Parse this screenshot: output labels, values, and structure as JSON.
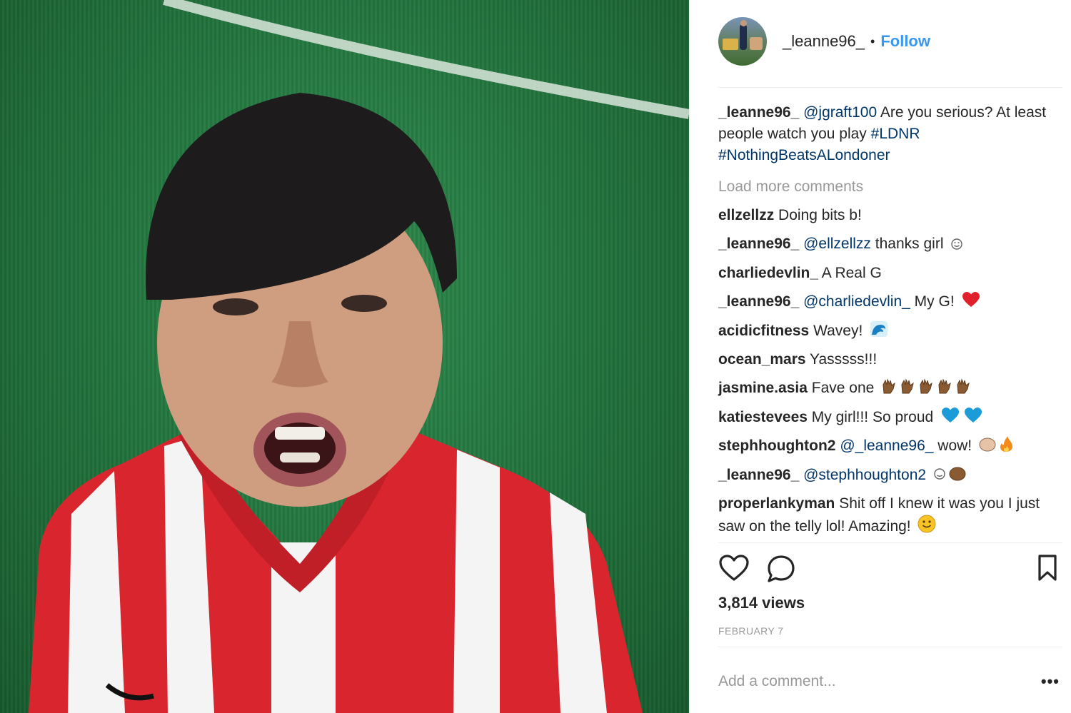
{
  "post": {
    "header": {
      "username": "_leanne96_",
      "separator": "•",
      "follow_label": "Follow"
    },
    "caption": {
      "username": "_leanne96_",
      "mention": "@jgraft100",
      "text": " Are you serious? At least people watch you play ",
      "hashtag1": "#LDNR",
      "hashtag2": "#NothingBeatsALondoner"
    },
    "load_more_label": "Load more comments",
    "comments": [
      {
        "user": "ellzellzz",
        "mention": "",
        "text": "Doing bits b!"
      },
      {
        "user": "_leanne96_",
        "mention": "@ellzellzz",
        "text": "thanks girl"
      },
      {
        "user": "charliedevlin_",
        "mention": "",
        "text": "A Real G"
      },
      {
        "user": "_leanne96_",
        "mention": "@charliedevlin_",
        "text": "My G!"
      },
      {
        "user": "acidicfitness",
        "mention": "",
        "text": "Wavey!"
      },
      {
        "user": "ocean_mars",
        "mention": "",
        "text": "Yasssss!!!"
      },
      {
        "user": "jasmine.asia",
        "mention": "",
        "text": "Fave one"
      },
      {
        "user": "katiestevees",
        "mention": "",
        "text": "My girl!!! So proud"
      },
      {
        "user": "stephhoughton2",
        "mention": "@_leanne96_",
        "text": "wow!"
      },
      {
        "user": "_leanne96_",
        "mention": "@stephhoughton2",
        "text": ""
      },
      {
        "user": "properlankyman",
        "mention": "",
        "text": "Shit off I knew it was you I just saw on the telly lol! Amazing!"
      }
    ],
    "icons": {
      "like": "heart-outline-icon",
      "comment": "speech-bubble-icon",
      "save": "bookmark-icon"
    },
    "views": "3,814 views",
    "date": "FEBRUARY 7",
    "add_comment_placeholder": "Add a comment...",
    "more_label": "•••"
  },
  "colors": {
    "link_blue": "#3897f0",
    "mention_navy": "#003569",
    "muted_gray": "#999999",
    "text_dark": "#262626",
    "heart_red": "#e0202a",
    "heart_blue": "#1b9bd8"
  }
}
